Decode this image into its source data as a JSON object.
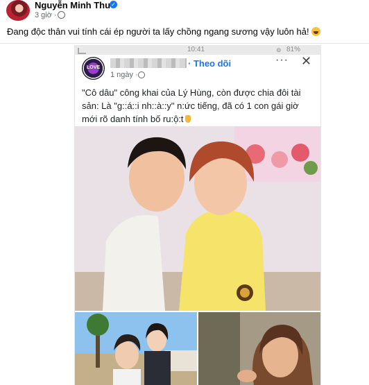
{
  "post": {
    "author_name": "Nguyễn Minh Thư",
    "verified_glyph": "✓",
    "time": "3 giờ ·",
    "caption": "Đang độc thân vui tính cái ép người ta lấy chồng ngang sương vậy luôn hả!",
    "caption_emoji": "rolling-laughing-emoji"
  },
  "shot": {
    "status_time": "10:41",
    "status_battery": "81%",
    "status_wifi": "⊚",
    "page_avatar_text": "LOVE",
    "follow_label": "· Theo dõi",
    "more_glyph": "···",
    "close_glyph": "✕",
    "post_time": "1 ngày ·",
    "text_line1": "\"Cô dâu\" công khai của Lý Hùng, còn được chia đôi tài",
    "text_line2": "sản: Là \"g::á::i nh::à::y\" n:ức tiếng, đã có 1 con gái giờ",
    "text_line3": "mới rõ danh tính bố ru:ộ:t",
    "hand_emoji": "pointing-down-emoji"
  },
  "icons": {
    "globe": "globe-icon",
    "verified": "verified-badge-icon",
    "more": "more-options-icon",
    "close": "close-icon"
  }
}
